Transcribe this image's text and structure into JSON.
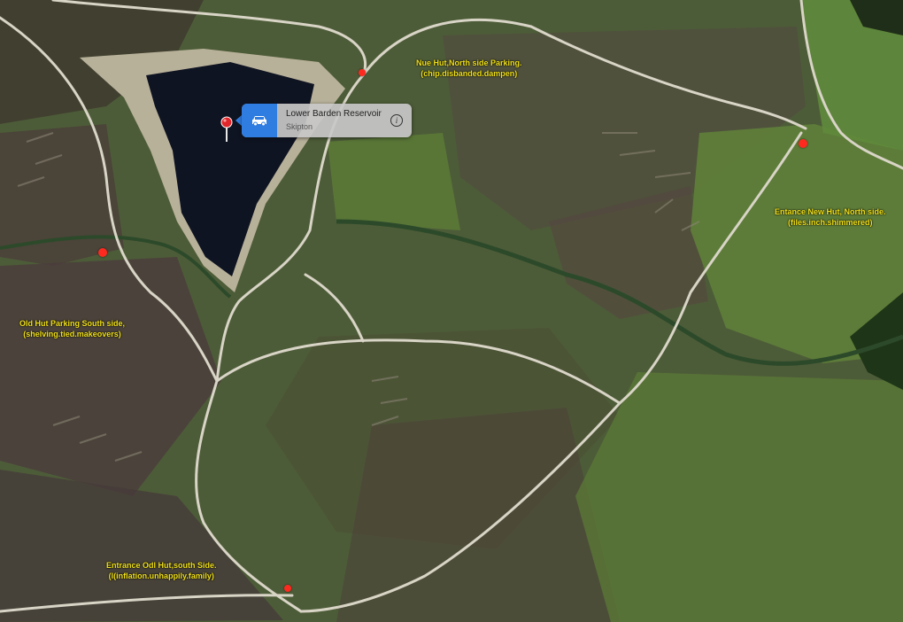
{
  "callout": {
    "title": "Lower Barden Reservoir",
    "subtitle": "Skipton",
    "car_icon": "car-icon",
    "info_icon": "info-icon",
    "info_glyph": "i",
    "accent": "#2f7de0"
  },
  "labels": {
    "nue_hut_line1": "Nue Hut,North side Parking.",
    "nue_hut_line2": "(chip.disbanded.dampen)",
    "new_hut_line1": "Entance New Hut, North side.",
    "new_hut_line2": "(files.inch.shimmered)",
    "old_hut_line1": "Old Hut Parking South side,",
    "old_hut_line2": "(shelving.tied.makeovers)",
    "odl_hut_line1": "Entrance Odl Hut,south Side.",
    "odl_hut_line2": "(l(inflation.unhappily.family)"
  },
  "colors": {
    "label": "#f2e21a",
    "marker": "#ff2a1f",
    "water": "#0f1422"
  }
}
